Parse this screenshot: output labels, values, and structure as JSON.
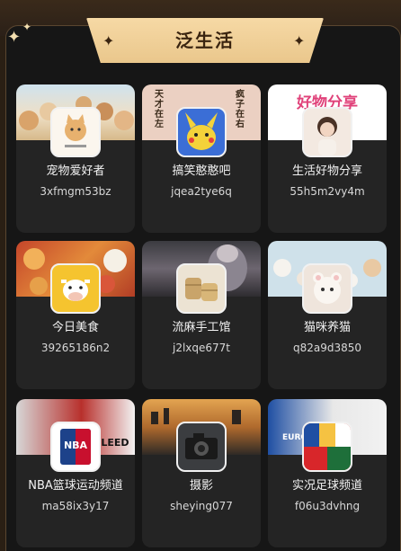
{
  "header": {
    "title": "泛生活"
  },
  "channels": [
    {
      "name": "宠物爱好者",
      "id": "3xfmgm53bz",
      "avatar_icon": "cat-icon"
    },
    {
      "name": "搞笑憨憨吧",
      "id": "jqea2tye6q",
      "avatar_icon": "pikachu-icon",
      "cover_left": "天才在左",
      "cover_right": "疯子在右"
    },
    {
      "name": "生活好物分享",
      "id": "55h5m2vy4m",
      "avatar_icon": "girl-photo-icon",
      "cover_text": "好物分享"
    },
    {
      "name": "今日美食",
      "id": "39265186n2",
      "avatar_icon": "cow-icon"
    },
    {
      "name": "流麻手工馆",
      "id": "j2lxqe677t",
      "avatar_icon": "handcraft-icon"
    },
    {
      "name": "猫咪养猫",
      "id": "q82a9d3850",
      "avatar_icon": "cat-photo-icon"
    },
    {
      "name": "NBA篮球运动频道",
      "id": "ma58ix3y17",
      "avatar_icon": "nba-logo-icon",
      "avatar_text": "NBA",
      "cover_text": "BLEED"
    },
    {
      "name": "摄影",
      "id": "sheying077",
      "avatar_icon": "camera-icon"
    },
    {
      "name": "实况足球频道",
      "id": "f06u3dvhng",
      "avatar_icon": "football-icon",
      "cover_text": "EURO"
    }
  ]
}
